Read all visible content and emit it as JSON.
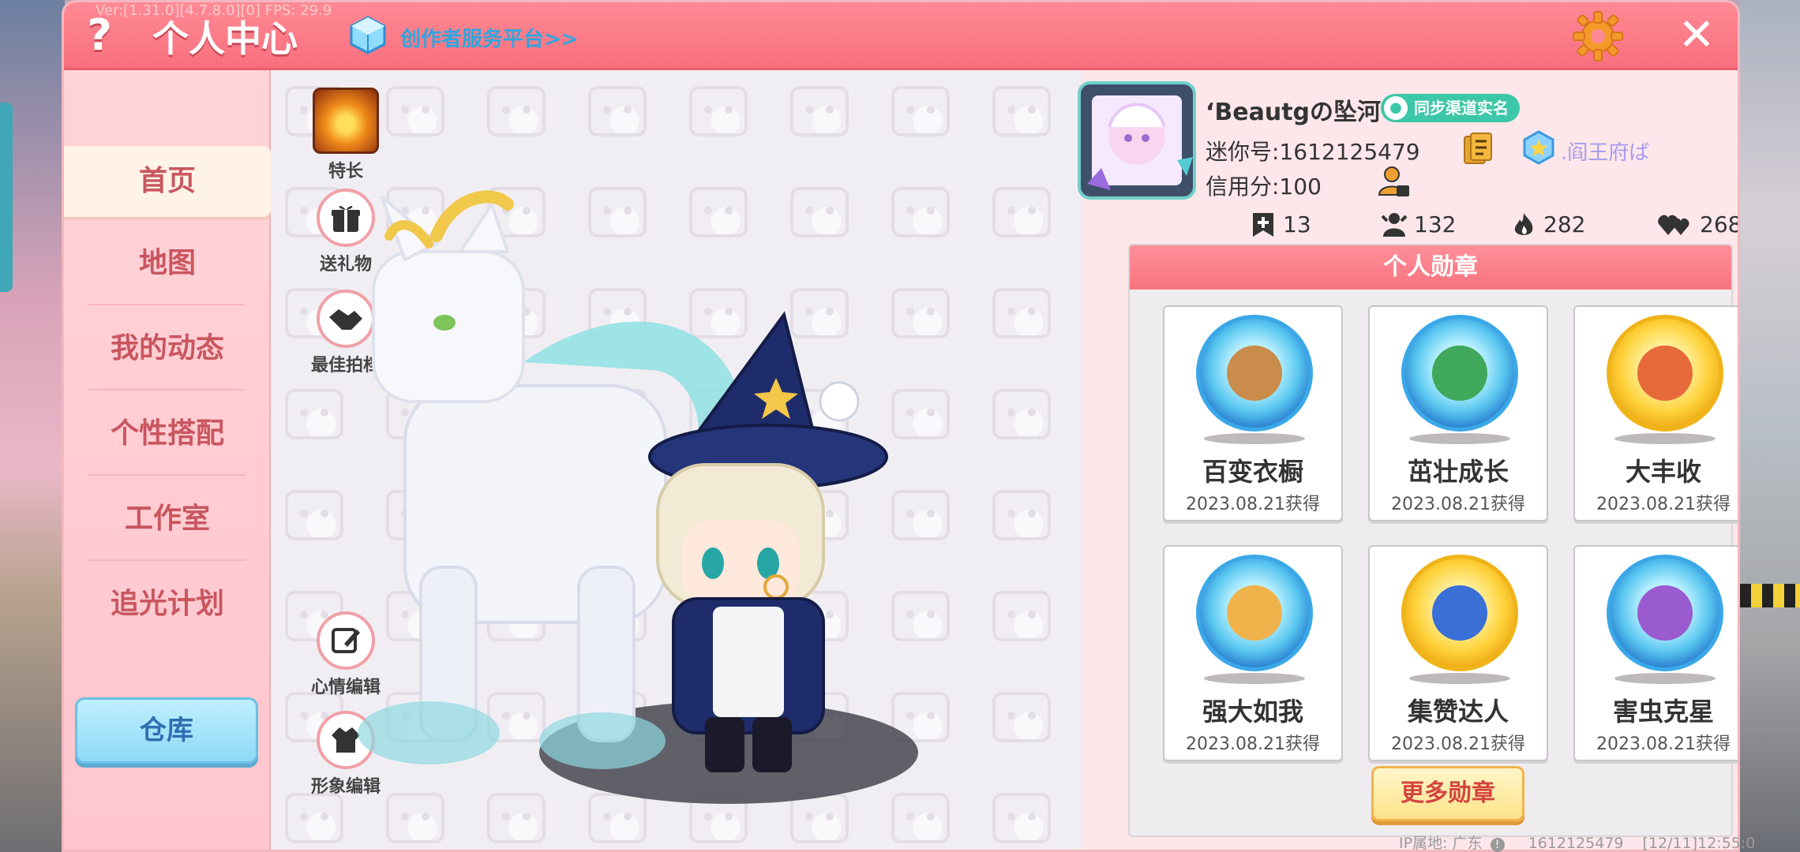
{
  "debug_text": "Ver:[1.31.0][4.7.8.0][0] FPS: 29.9",
  "header": {
    "help_label": "?",
    "title": "个人中心",
    "creator_link": "创作者服务平台>>",
    "close_label": "✕"
  },
  "nav": {
    "items": [
      {
        "label": "首页",
        "active": true
      },
      {
        "label": "地图"
      },
      {
        "label": "我的动态"
      },
      {
        "label": "个性搭配"
      },
      {
        "label": "工作室"
      },
      {
        "label": "追光计划"
      }
    ],
    "warehouse_label": "仓库"
  },
  "stage_actions": {
    "talent": "特长",
    "gift": "送礼物",
    "partner": "最佳拍档",
    "mood_edit": "心情编辑",
    "look_edit": "形象编辑"
  },
  "profile": {
    "username": "‘Beautgの坠河",
    "realname_badge": "同步渠道实名",
    "mini_id": "迷你号:1612125479",
    "guild": ".阎王府ば",
    "credit": "信用分:100",
    "stats": {
      "posts": "13",
      "followers": "132",
      "popularity": "282",
      "likes": "268"
    }
  },
  "medals": {
    "header": "个人勋章",
    "items": [
      {
        "name": "百变衣橱",
        "date": "2023.08.21获得",
        "style": "blue"
      },
      {
        "name": "茁壮成长",
        "date": "2023.08.21获得",
        "style": "blue"
      },
      {
        "name": "大丰收",
        "date": "2023.08.21获得",
        "style": "gold"
      },
      {
        "name": "强大如我",
        "date": "2023.08.21获得",
        "style": "blue"
      },
      {
        "name": "集赞达人",
        "date": "2023.08.21获得",
        "style": "gold"
      },
      {
        "name": "害虫克星",
        "date": "2023.08.21获得",
        "style": "blue"
      }
    ],
    "more_label": "更多勋章"
  },
  "footer": {
    "ip_label": "IP属地: 广东",
    "uid": "1612125479",
    "time": "[12/11]12:55:0"
  },
  "colors": {
    "title_bar": "#f86f7d",
    "nav_text": "#c9565f",
    "link": "#2ea6e0",
    "realname": "#3cc7a8",
    "more_btn_text": "#d2443f"
  }
}
